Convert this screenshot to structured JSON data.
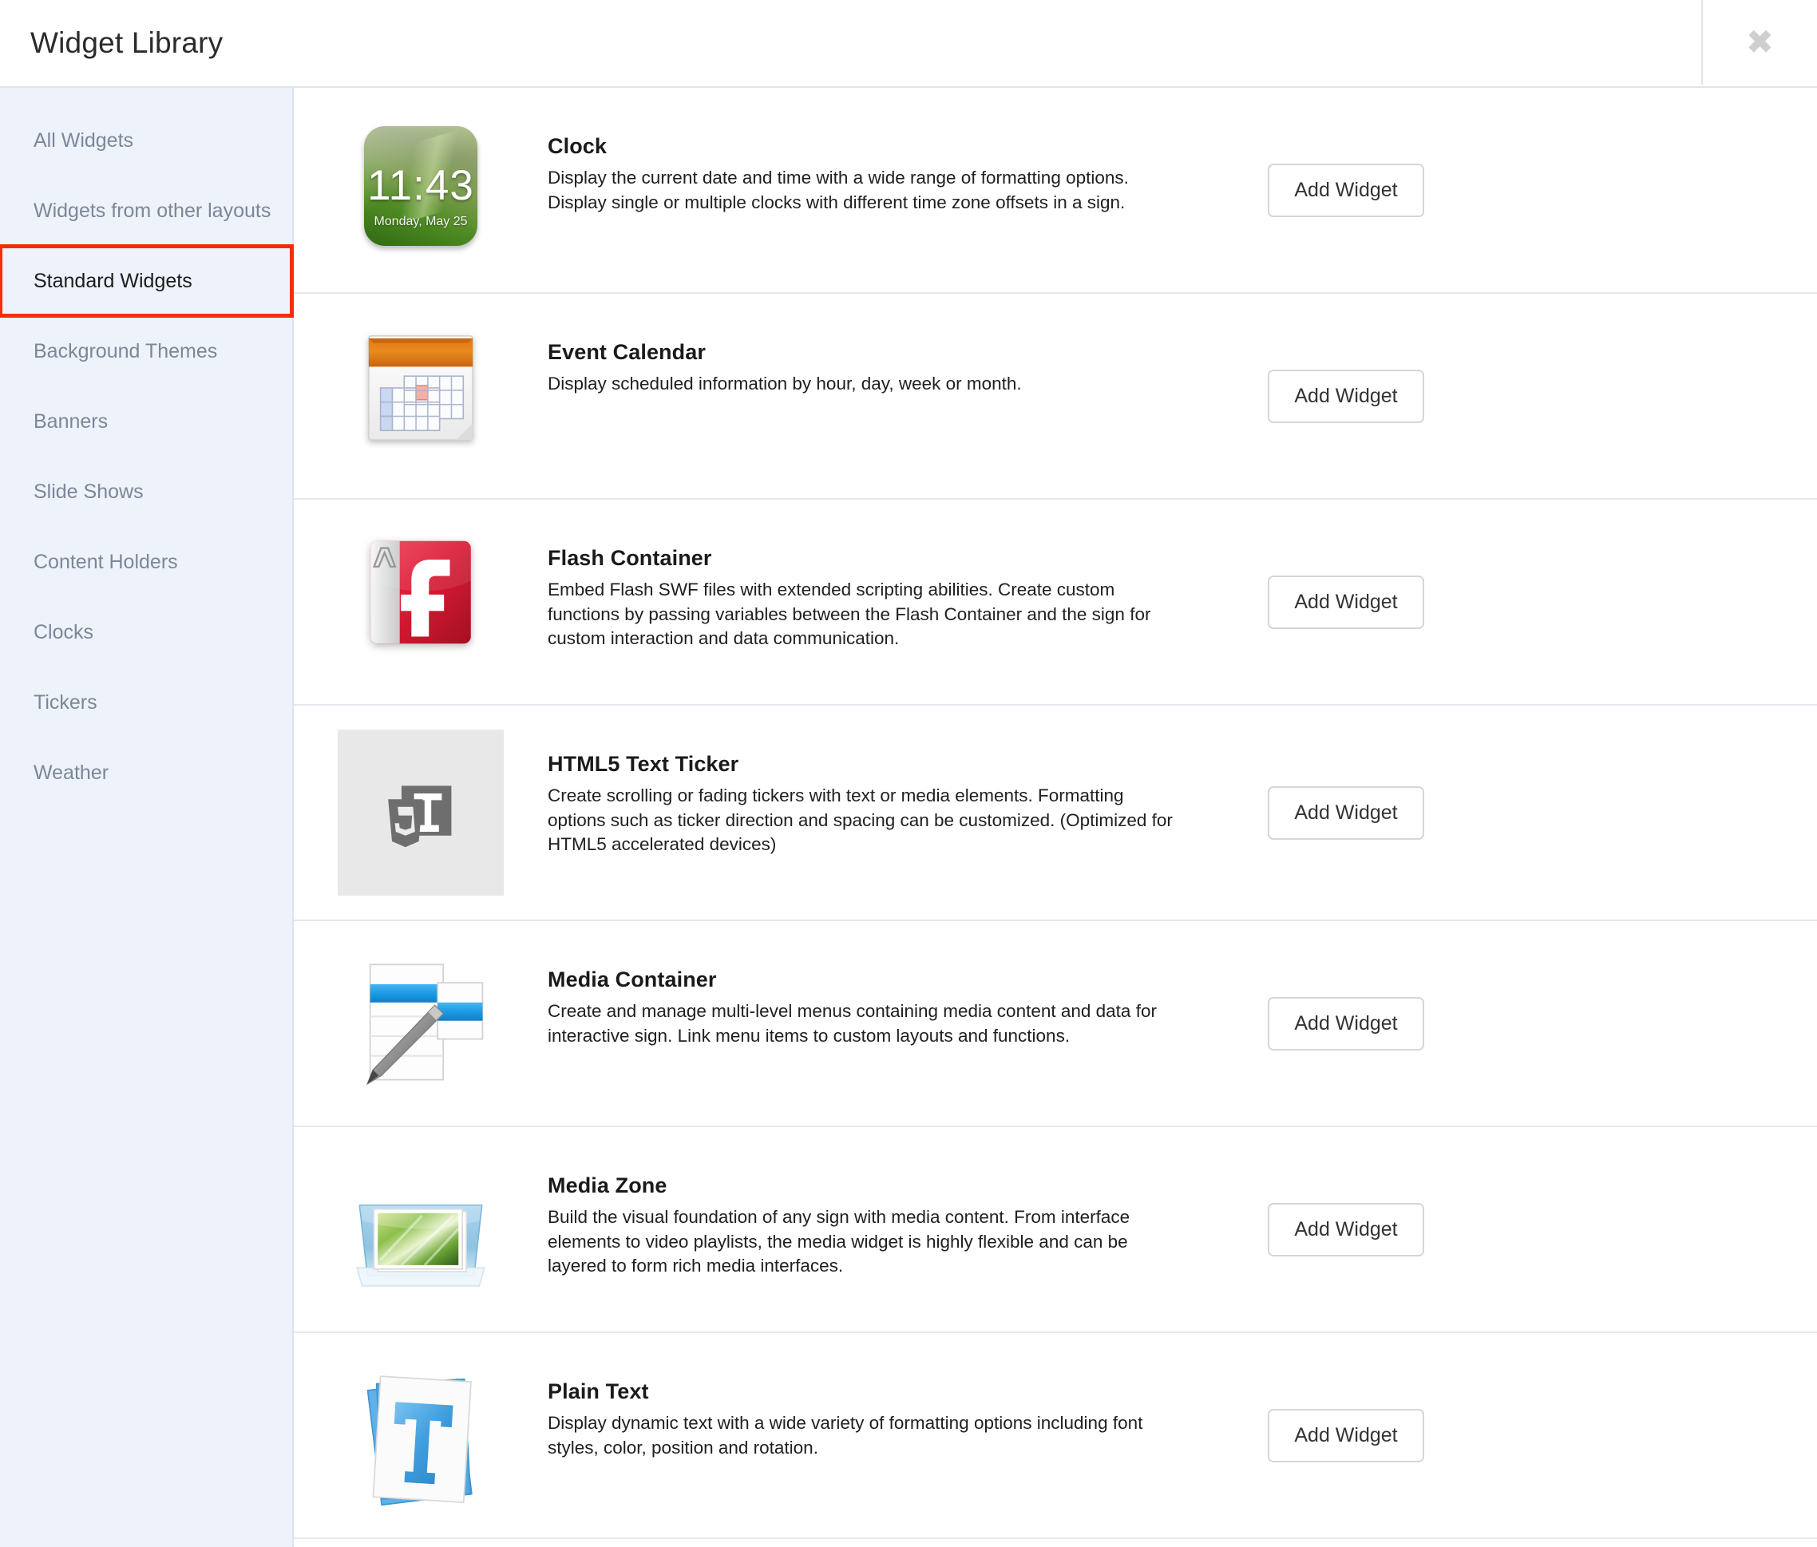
{
  "header": {
    "title": "Widget Library",
    "close_label": "✖"
  },
  "sidebar": {
    "items": [
      {
        "label": "All Widgets",
        "active": false
      },
      {
        "label": "Widgets from other layouts",
        "active": false
      },
      {
        "label": "Standard Widgets",
        "active": true,
        "highlight": true,
        "highlight_color": "#f62d0a"
      },
      {
        "label": "Background Themes",
        "active": false
      },
      {
        "label": "Banners",
        "active": false
      },
      {
        "label": "Slide Shows",
        "active": false
      },
      {
        "label": "Content Holders",
        "active": false
      },
      {
        "label": "Clocks",
        "active": false
      },
      {
        "label": "Tickers",
        "active": false
      },
      {
        "label": "Weather",
        "active": false
      }
    ]
  },
  "widgets": [
    {
      "icon": "clock-icon",
      "title": "Clock",
      "description": "Display the current date and time with a wide range of formatting options. Display single or multiple clocks with different time zone offsets in a sign.",
      "button_label": "Add Widget",
      "icon_text": {
        "time": "11:43",
        "date": "Monday, May 25"
      }
    },
    {
      "icon": "calendar-icon",
      "title": "Event Calendar",
      "description": "Display scheduled information by hour, day, week or month.",
      "button_label": "Add Widget"
    },
    {
      "icon": "flash-icon",
      "title": "Flash Container",
      "description": "Embed Flash SWF files with extended scripting abilities. Create custom functions by passing variables between the Flash Container and the sign for custom interaction and data communication.",
      "button_label": "Add Widget"
    },
    {
      "icon": "html5-ticker-icon",
      "title": "HTML5 Text Ticker",
      "description": "Create scrolling or fading tickers with text or media elements. Formatting options such as ticker direction and spacing can be customized. (Optimized for HTML5 accelerated devices)",
      "button_label": "Add Widget"
    },
    {
      "icon": "media-container-icon",
      "title": "Media Container",
      "description": "Create and manage multi-level menus containing media content and data for interactive sign. Link menu items to custom layouts and functions.",
      "button_label": "Add Widget"
    },
    {
      "icon": "media-zone-icon",
      "title": "Media Zone",
      "description": "Build the visual foundation of any sign with media content. From interface elements to video playlists, the media widget is highly flexible and can be layered to form rich media interfaces.",
      "button_label": "Add Widget"
    },
    {
      "icon": "plain-text-icon",
      "title": "Plain Text",
      "description": "Display dynamic text with a wide variety of formatting options including font styles, color, position and rotation.",
      "button_label": "Add Widget"
    }
  ],
  "colors": {
    "sidebar_bg": "#eef2fa",
    "highlight": "#f62d0a",
    "muted_text": "#7c8798",
    "border": "#e6e8ec"
  }
}
